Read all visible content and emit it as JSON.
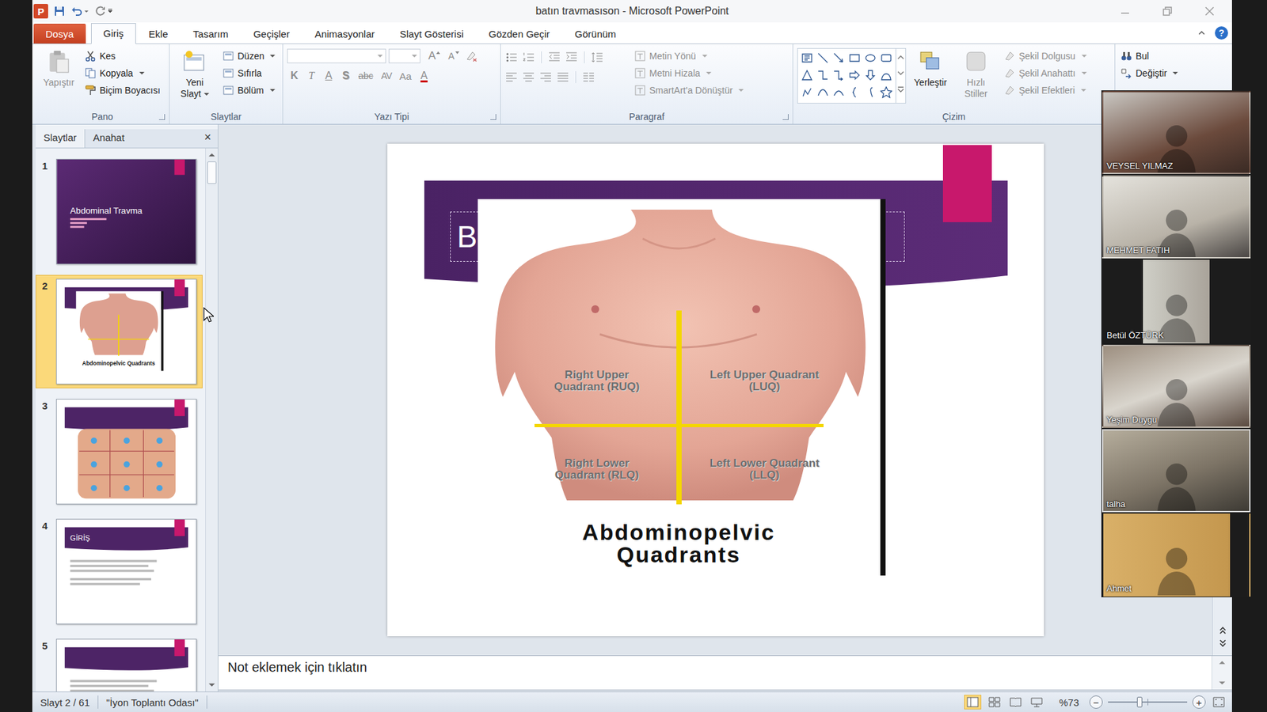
{
  "window": {
    "title": "batın travmasıson - Microsoft PowerPoint",
    "logo": "P"
  },
  "ribbon_tabs": [
    {
      "label": "Dosya",
      "selected": false,
      "kind": "file"
    },
    {
      "label": "Giriş",
      "selected": true,
      "kind": "tab"
    },
    {
      "label": "Ekle",
      "selected": false,
      "kind": "tab"
    },
    {
      "label": "Tasarım",
      "selected": false,
      "kind": "tab"
    },
    {
      "label": "Geçişler",
      "selected": false,
      "kind": "tab"
    },
    {
      "label": "Animasyonlar",
      "selected": false,
      "kind": "tab"
    },
    {
      "label": "Slayt Gösterisi",
      "selected": false,
      "kind": "tab"
    },
    {
      "label": "Gözden Geçir",
      "selected": false,
      "kind": "tab"
    },
    {
      "label": "Görünüm",
      "selected": false,
      "kind": "tab"
    }
  ],
  "help": "?",
  "clipboard": {
    "label": "Pano",
    "paste": {
      "label": "Yapıştır",
      "disabled": true
    },
    "items": [
      {
        "label": "Kes",
        "dropdown": false
      },
      {
        "label": "Kopyala",
        "dropdown": true
      },
      {
        "label": "Biçim Boyacısı",
        "dropdown": false
      }
    ]
  },
  "slides_group": {
    "label": "Slaytlar",
    "new_slide": {
      "label": "Yeni Slayt",
      "dropdown": true
    },
    "items": [
      {
        "label": "Düzen",
        "dropdown": true
      },
      {
        "label": "Sıfırla",
        "dropdown": false
      },
      {
        "label": "Bölüm",
        "dropdown": true
      }
    ]
  },
  "font": {
    "label": "Yazı Tipi",
    "disabled": true,
    "size_buttons": [
      {
        "label": "A",
        "kind": "grow"
      },
      {
        "label": "A",
        "kind": "shrink"
      }
    ],
    "format_buttons": [
      {
        "label": "K",
        "kind": "bold"
      },
      {
        "label": "T",
        "kind": "italic"
      },
      {
        "label": "A",
        "kind": "underline"
      },
      {
        "label": "S",
        "kind": "shadow"
      },
      {
        "label": "abc",
        "kind": "strike"
      },
      {
        "label": "AV",
        "kind": "spacing"
      },
      {
        "label": "Aa",
        "kind": "case"
      },
      {
        "label": "A",
        "kind": "color"
      }
    ]
  },
  "paragraph": {
    "label": "Paragraf",
    "items": [
      {
        "label": "Metin Yönü",
        "disabled": true
      },
      {
        "label": "Metni Hizala",
        "disabled": true
      },
      {
        "label": "SmartArt'a Dönüştür",
        "disabled": true
      }
    ]
  },
  "drawing": {
    "label": "Çizim",
    "arrange": {
      "label": "Yerleştir",
      "disabled": false
    },
    "quick_styles": {
      "label": "Hızlı Stiller",
      "disabled": true
    },
    "items": [
      {
        "label": "Şekil Dolgusu",
        "disabled": true
      },
      {
        "label": "Şekil Anahattı",
        "disabled": true
      },
      {
        "label": "Şekil Efektleri",
        "disabled": true
      }
    ]
  },
  "editing": {
    "items": [
      {
        "label": "Bul",
        "dropdown": false
      },
      {
        "label": "Değiştir",
        "dropdown": true
      }
    ]
  },
  "slides_pane": {
    "tabs": [
      {
        "label": "Slaytlar",
        "selected": true
      },
      {
        "label": "Anahat",
        "selected": false
      }
    ],
    "close": "×",
    "thumbnails": [
      {
        "number": "1",
        "selected": false,
        "kind": "title",
        "title": "Abdominal Travma"
      },
      {
        "number": "2",
        "selected": true,
        "kind": "image"
      },
      {
        "number": "3",
        "selected": false,
        "kind": "regions"
      },
      {
        "number": "4",
        "selected": false,
        "kind": "bullets",
        "title": "GİRİŞ"
      },
      {
        "number": "5",
        "selected": false,
        "kind": "bullets"
      }
    ]
  },
  "slide": {
    "title": "B",
    "image": {
      "quadrants": [
        {
          "label": "Right Upper Quadrant (RUQ)"
        },
        {
          "label": "Left Upper Quadrant (LUQ)"
        },
        {
          "label": "Right Lower Quadrant (RLQ)"
        },
        {
          "label": "Left Lower Quadrant (LLQ)"
        }
      ],
      "caption": "Abdominopelvic Quadrants"
    }
  },
  "notes": {
    "placeholder": "Not eklemek için tıklatın"
  },
  "status_bar": {
    "slide": "Slayt 2 / 61",
    "theme": "\"İyon Toplantı Odası\"",
    "zoom": "%73",
    "zoom_level": 0.4,
    "zoom_out": "−",
    "zoom_in": "+"
  },
  "participants": [
    {
      "name": "VEYSEL YILMAZ",
      "speaking": false
    },
    {
      "name": "MEHMET FATIH",
      "speaking": false
    },
    {
      "name": "Betül ÖZTÜRK",
      "speaking": false
    },
    {
      "name": "Yeşim Duygu",
      "speaking": false
    },
    {
      "name": "talha",
      "speaking": true
    },
    {
      "name": "Ahmet",
      "speaking": false
    }
  ]
}
